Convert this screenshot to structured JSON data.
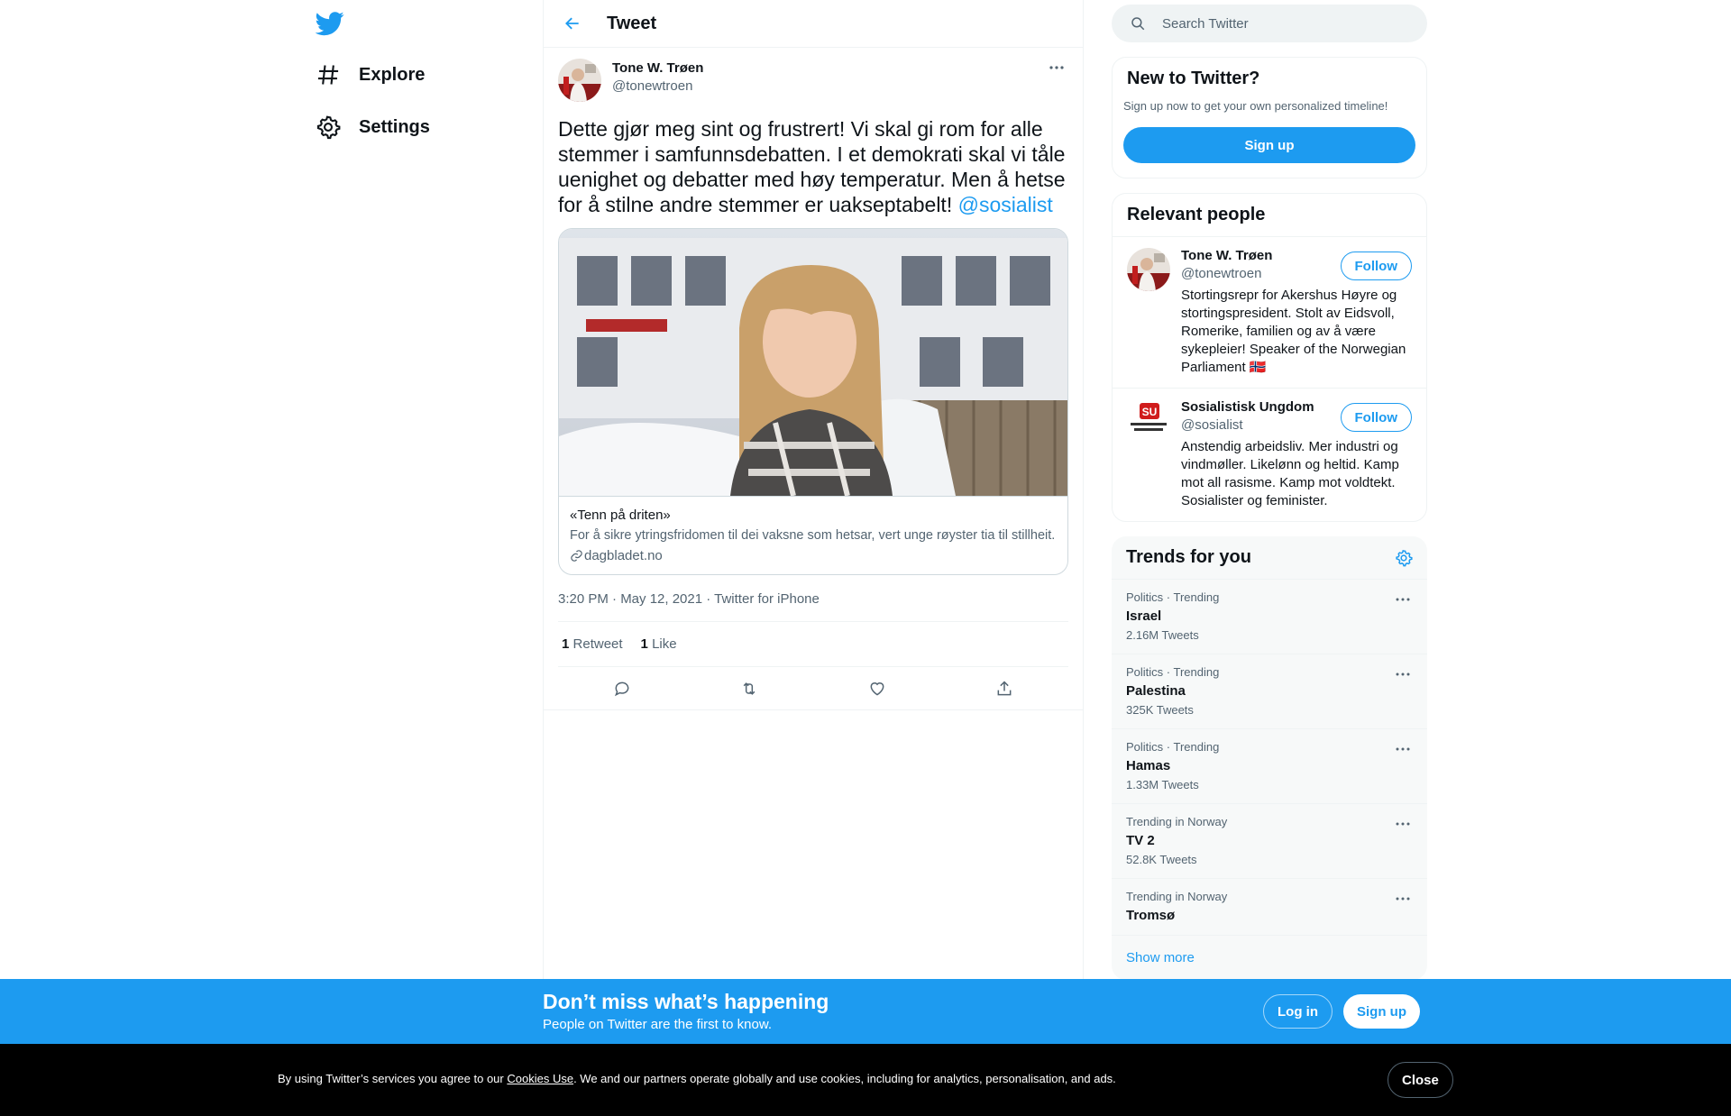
{
  "nav": {
    "logo_icon": "twitter-bird-icon",
    "items": [
      {
        "label": "Explore",
        "icon": "hashtag-icon"
      },
      {
        "label": "Settings",
        "icon": "gear-icon"
      }
    ]
  },
  "header": {
    "title": "Tweet",
    "back_icon": "arrow-left-icon"
  },
  "tweet": {
    "author_name": "Tone W. Trøen",
    "author_handle": "@tonewtroen",
    "text": "Dette gjør meg sint og frustrert! Vi skal gi rom for alle stemmer i samfunnsdebatten. I et demokrati skal vi tåle uenighet og debatter med høy temperatur. Men å hetse for å stilne andre stemmer er uakseptabelt!",
    "mention": "@sosialist",
    "card": {
      "title": "«Tenn på driten»",
      "description": "For å sikre ytringsfridomen til dei vaksne som hetsar, vert unge røyster tia til stillheit.",
      "domain": "dagbladet.no"
    },
    "meta": "3:20 PM · May 12, 2021 · Twitter for iPhone",
    "retweets": "1",
    "retweets_label": "Retweet",
    "likes": "1",
    "likes_label": "Like"
  },
  "search": {
    "placeholder": "Search Twitter"
  },
  "new_to_twitter": {
    "title": "New to Twitter?",
    "subtitle": "Sign up now to get your own personalized timeline!",
    "button": "Sign up"
  },
  "relevant": {
    "title": "Relevant people",
    "people": [
      {
        "name": "Tone W. Trøen",
        "handle": "@tonewtroen",
        "bio": "Stortingsrepr for Akershus Høyre og stortingspresident. Stolt av Eidsvoll, Romerike, familien og av å være sykepleier! Speaker of the Norwegian Parliament 🇳🇴",
        "follow": "Follow"
      },
      {
        "name": "Sosialistisk Ungdom",
        "handle": "@sosialist",
        "bio": "Anstendig arbeidsliv. Mer industri og vindmøller. Likelønn og heltid. Kamp mot all rasisme. Kamp mot voldtekt. Sosialister og feminister.",
        "follow": "Follow"
      }
    ]
  },
  "trends": {
    "title": "Trends for you",
    "items": [
      {
        "context": "Politics · Trending",
        "name": "Israel",
        "count": "2.16M Tweets"
      },
      {
        "context": "Politics · Trending",
        "name": "Palestina",
        "count": "325K Tweets"
      },
      {
        "context": "Politics · Trending",
        "name": "Hamas",
        "count": "1.33M Tweets"
      },
      {
        "context": "Trending in Norway",
        "name": "TV 2",
        "count": "52.8K Tweets"
      },
      {
        "context": "Trending in Norway",
        "name": "Tromsø",
        "count": ""
      }
    ],
    "show_more": "Show more"
  },
  "bottom_bar": {
    "title": "Don’t miss what’s happening",
    "subtitle": "People on Twitter are the first to know.",
    "login": "Log in",
    "signup": "Sign up"
  },
  "cookie": {
    "prefix": "By using Twitter’s services you agree to our ",
    "link": "Cookies Use",
    "suffix": ". We and our partners operate globally and use cookies, including for analytics, personalisation, and ads.",
    "close": "Close"
  },
  "colors": {
    "accent": "#1d9bf0",
    "text": "#0f1419",
    "muted": "#536471",
    "border": "#eff3f4"
  }
}
